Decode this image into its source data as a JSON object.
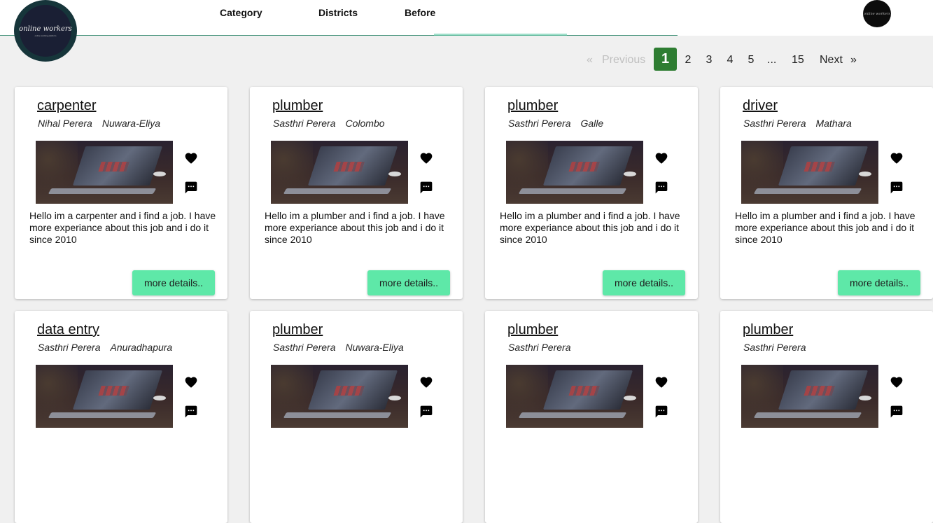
{
  "header": {
    "logo_text": "online workers",
    "logo_subtext": "online working platform",
    "avatar_text": "online workers",
    "nav": [
      "Category",
      "Districts",
      "Before"
    ]
  },
  "pagination": {
    "previous": "Previous",
    "prev_arrow": "«",
    "next": "Next",
    "next_arrow": "»",
    "current": "1",
    "pages": [
      "2",
      "3",
      "4",
      "5"
    ],
    "ellipsis": "...",
    "last": "15"
  },
  "cards": [
    {
      "title": "carpenter",
      "name": "Nihal Perera",
      "district": "Nuwara-Eliya",
      "desc": "Hello im a carpenter and i find a job. I have more experiance about this job and i do it since 2010",
      "button": "more details.."
    },
    {
      "title": "plumber",
      "name": "Sasthri Perera",
      "district": "Colombo",
      "desc": "Hello im a plumber and i find a job. I have more experiance about this job and i do it since 2010",
      "button": "more details.."
    },
    {
      "title": "plumber",
      "name": "Sasthri Perera",
      "district": "Galle",
      "desc": "Hello im a plumber and i find a job. I have more experiance about this job and i do it since 2010",
      "button": "more details.."
    },
    {
      "title": "driver",
      "name": "Sasthri Perera",
      "district": "Mathara",
      "desc": "Hello im a plumber and i find a job. I have more experiance about this job and i do it since 2010",
      "button": "more details.."
    },
    {
      "title": "data entry",
      "name": "Sasthri Perera",
      "district": "Anuradhapura",
      "desc": "",
      "button": ""
    },
    {
      "title": "plumber",
      "name": "Sasthri Perera",
      "district": "Nuwara-Eliya",
      "desc": "",
      "button": ""
    },
    {
      "title": "plumber",
      "name": "Sasthri Perera",
      "district": "",
      "desc": "",
      "button": ""
    },
    {
      "title": "plumber",
      "name": "Sasthri Perera",
      "district": "",
      "desc": "",
      "button": ""
    }
  ],
  "icons": {
    "favorite": "heart-icon",
    "message": "chat-icon"
  },
  "colors": {
    "accent_button": "#5ee8a8",
    "active_page": "#2e7d32",
    "header_line": "#3f8f76",
    "background": "#f0f0f0"
  }
}
